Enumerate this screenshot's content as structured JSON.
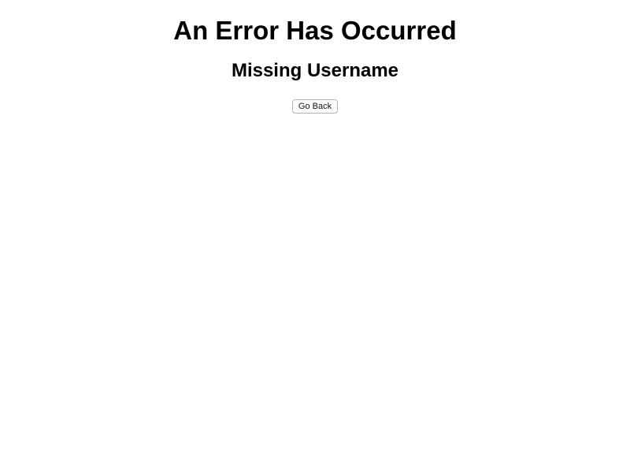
{
  "page": {
    "title": "An Error Has Occurred",
    "message": "Missing Username",
    "back_button_label": "Go Back"
  }
}
